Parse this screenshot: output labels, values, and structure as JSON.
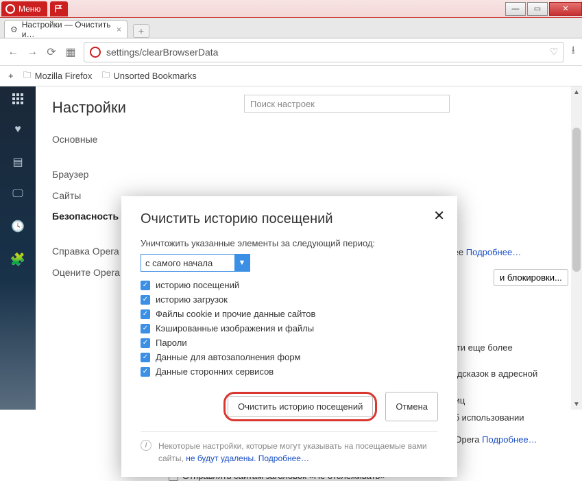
{
  "window": {
    "menu_label": "Меню"
  },
  "tab": {
    "title": "Настройки — Очистить и…"
  },
  "address": "settings/clearBrowserData",
  "bookmarks_bar": {
    "items": [
      "Mozilla Firefox",
      "Unsorted Bookmarks"
    ]
  },
  "settings": {
    "title": "Настройки",
    "search_placeholder": "Поиск настроек",
    "nav": {
      "basic": "Основные",
      "browser": "Браузер",
      "sites": "Сайты",
      "security": "Безопасность",
      "help": "Справка Opera",
      "rate": "Оцените Opera"
    },
    "bg": {
      "faster": "стрее",
      "more_link": "Подробнее…",
      "block_btn": "и блокировки...",
      "snip1": "в сети еще более",
      "snip2": "е подсказок в адресной",
      "snip3": "раниц",
      "snip4": "ю об использовании",
      "snip5": "и в Opera",
      "more_link2": "Подробнее…",
      "dnt": "Отправлять сайтам заголовок «Не отслеживать»"
    }
  },
  "dialog": {
    "title": "Очистить историю посещений",
    "subtitle": "Уничтожить указанные элементы за следующий период:",
    "period_selected": "с самого начала",
    "options": [
      "историю посещений",
      "историю загрузок",
      "Файлы cookie и прочие данные сайтов",
      "Кэшированные изображения и файлы",
      "Пароли",
      "Данные для автозаполнения форм",
      "Данные сторонних сервисов"
    ],
    "clear_btn": "Очистить историю посещений",
    "cancel_btn": "Отмена",
    "footer_text": "Некоторые настройки, которые могут указывать на посещаемые вами сайты,",
    "footer_link1": "не будут удалены.",
    "footer_link2": "Подробнее…"
  }
}
